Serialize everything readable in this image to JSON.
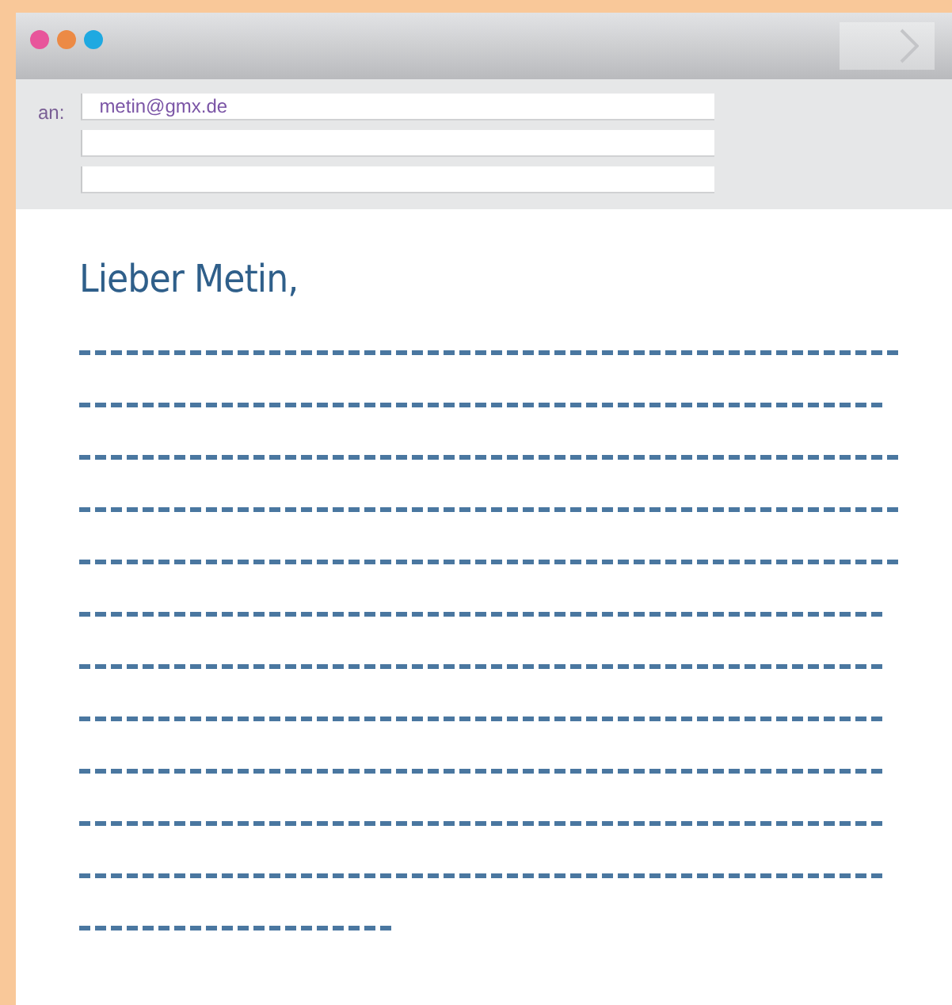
{
  "window": {
    "traffic_lights": [
      {
        "color": "#e8559b"
      },
      {
        "color": "#ec8a45"
      },
      {
        "color": "#1fa9e1"
      }
    ]
  },
  "header": {
    "to_label": "an:",
    "to_fields": [
      {
        "kind": "address",
        "value": "metin@gmx.de"
      },
      {
        "kind": "blank"
      },
      {
        "kind": "blank"
      }
    ]
  },
  "letter": {
    "greeting": "Lieber Metin,",
    "writing_lines": [
      {
        "kind": "long"
      },
      {
        "kind": "medium"
      },
      {
        "kind": "long"
      },
      {
        "kind": "long"
      },
      {
        "kind": "long"
      },
      {
        "kind": "medium"
      },
      {
        "kind": "medium"
      },
      {
        "kind": "medium"
      },
      {
        "kind": "medium"
      },
      {
        "kind": "medium"
      },
      {
        "kind": "medium"
      },
      {
        "kind": "short"
      }
    ]
  }
}
